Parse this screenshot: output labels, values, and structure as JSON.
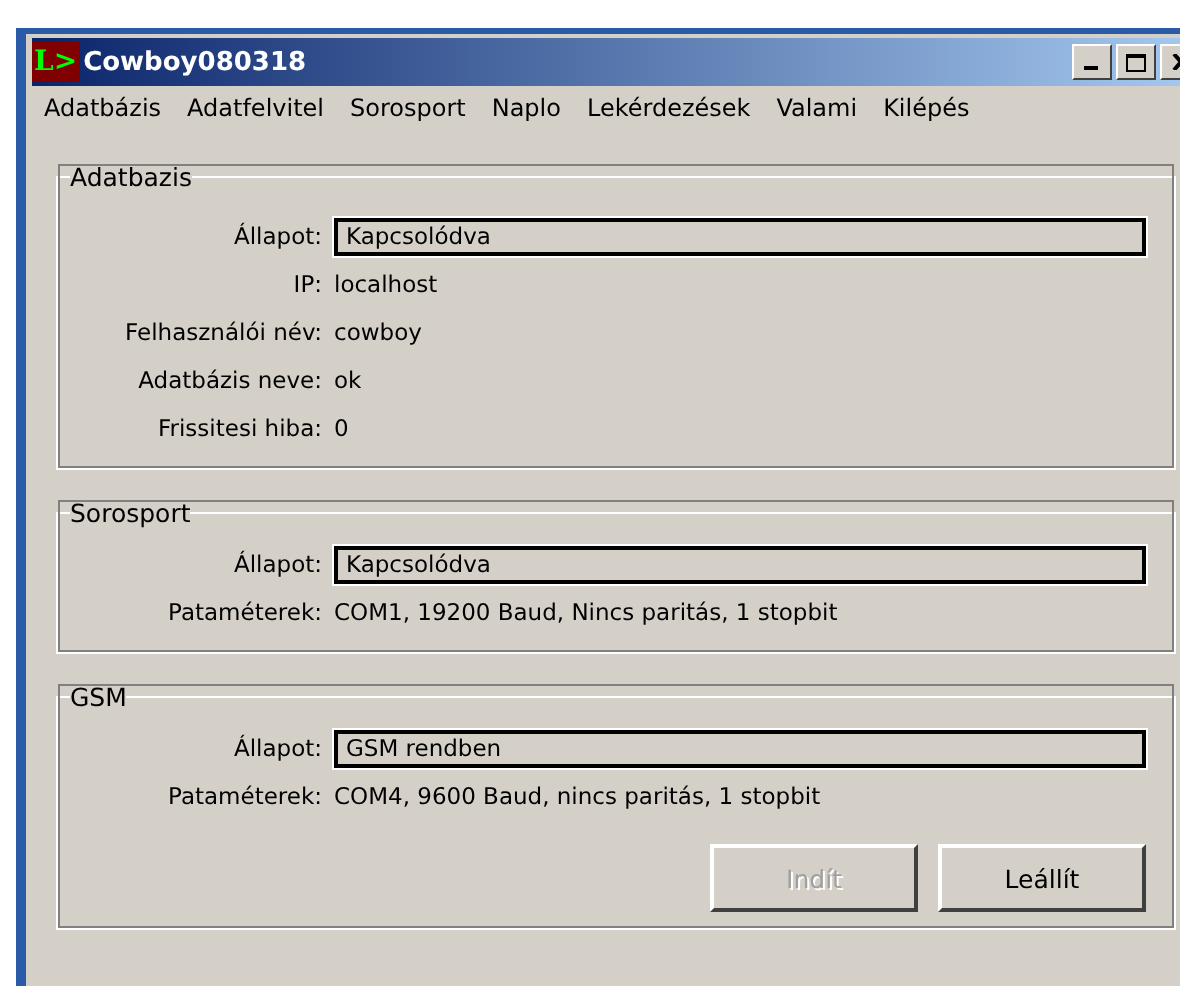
{
  "window": {
    "logo": "L>",
    "title": "Cowboy080318"
  },
  "menu": [
    "Adatbázis",
    "Adatfelvitel",
    "Sorosport",
    "Naplo",
    "Lekérdezések",
    "Valami",
    "Kilépés"
  ],
  "groups": [
    {
      "title": "Adatbazis",
      "rows": [
        {
          "label": "Állapot:",
          "value": "Kapcsolódva",
          "kind": "field"
        },
        {
          "label": "IP:",
          "value": "localhost",
          "kind": "text"
        },
        {
          "label": "Felhasználói név:",
          "value": "cowboy",
          "kind": "text"
        },
        {
          "label": "Adatbázis neve:",
          "value": "ok",
          "kind": "text"
        },
        {
          "label": "Frissitesi hiba:",
          "value": "0",
          "kind": "text"
        }
      ]
    },
    {
      "title": "Sorosport",
      "rows": [
        {
          "label": "Állapot:",
          "value": "Kapcsolódva",
          "kind": "field"
        },
        {
          "label": "Pataméterek:",
          "value": "COM1, 19200 Baud, Nincs paritás, 1 stopbit",
          "kind": "text"
        }
      ]
    },
    {
      "title": "GSM",
      "rows": [
        {
          "label": "Állapot:",
          "value": "GSM rendben",
          "kind": "field"
        },
        {
          "label": "Pataméterek:",
          "value": "COM4, 9600 Baud, nincs paritás, 1 stopbit",
          "kind": "text"
        }
      ],
      "buttons": [
        {
          "label": "Indít",
          "disabled": true
        },
        {
          "label": "Leállít",
          "disabled": false
        }
      ]
    }
  ]
}
